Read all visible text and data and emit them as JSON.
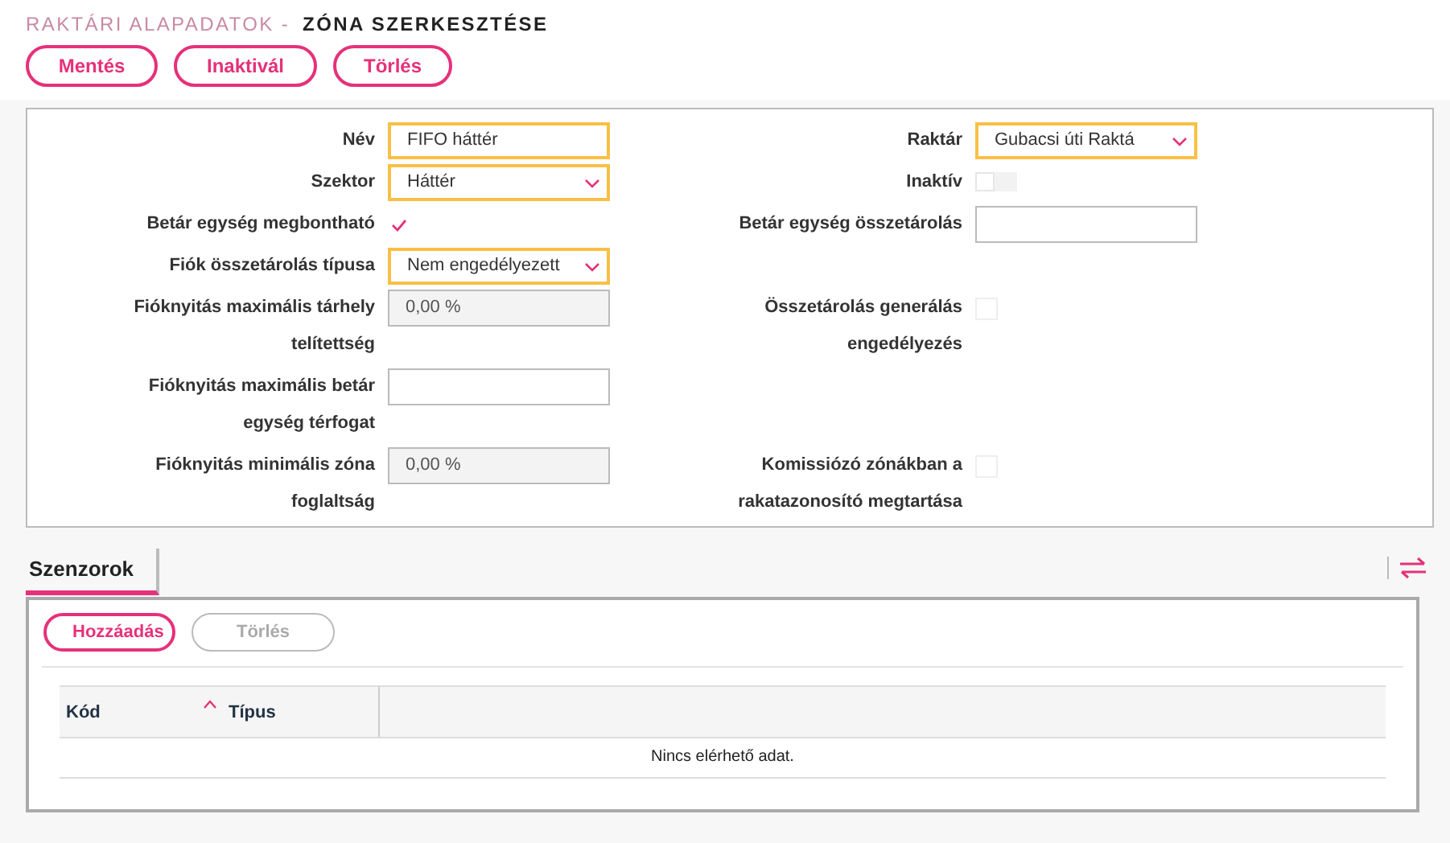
{
  "header": {
    "breadcrumb": "RAKTÁRI ALAPADATOK -",
    "title": "ZÓNA SZERKESZTÉSE"
  },
  "actions": [
    {
      "label": "Mentés",
      "disabled": false
    },
    {
      "label": "Inaktivál",
      "disabled": false
    },
    {
      "label": "Törlés",
      "disabled": false
    }
  ],
  "form": {
    "rows": [
      {
        "left": {
          "label": "Név",
          "kind": "text",
          "value": "FIFO háttér",
          "required": true,
          "disabled": false
        },
        "right": {
          "label": "Raktár",
          "kind": "select",
          "value": "Gubacsi úti Raktá",
          "required": true,
          "disabled": false
        }
      },
      {
        "left": {
          "label": "Szektor",
          "kind": "select",
          "value": "Háttér",
          "required": true,
          "disabled": false
        },
        "right": {
          "label": "Inaktív",
          "kind": "toggle",
          "on": false
        }
      },
      {
        "left": {
          "label": "Betár egység megbontható",
          "kind": "checkbox",
          "checked": true
        },
        "right": {
          "label": "Betár egység összetárolás",
          "kind": "text",
          "required": false,
          "disabled": false
        }
      },
      {
        "left": {
          "label": "Fiók összetárolás típusa",
          "kind": "select",
          "value": "Nem engedélyezett",
          "required": true,
          "disabled": false
        }
      },
      {
        "left": {
          "label": "Fióknyitás maximális tárhely telítettség",
          "kind": "text",
          "value": "0,00 %",
          "required": false,
          "disabled": true
        },
        "right": {
          "label": "Összetárolás generálás engedélyezés",
          "kind": "checkbox",
          "checked": false
        }
      },
      {
        "left": {
          "label": "Fióknyitás maximális betár egység térfogat",
          "kind": "text",
          "required": false,
          "disabled": false
        }
      },
      {
        "left": {
          "label": "Fióknyitás minimális zóna foglaltság",
          "kind": "text",
          "value": "0,00 %",
          "required": false,
          "disabled": true
        },
        "right": {
          "label": "Komissiózó zónákban a rakatazonosító megtartása",
          "kind": "checkbox",
          "checked": false
        }
      }
    ]
  },
  "tabs": [
    {
      "label": "Szenzorok",
      "selected": true
    }
  ],
  "sensors": {
    "buttons": [
      {
        "label": "Hozzáadás",
        "disabled": false
      },
      {
        "label": "Törlés",
        "disabled": true
      }
    ],
    "table": {
      "columns": [
        {
          "label": "Kód",
          "sorted": true
        },
        {
          "label": "Típus",
          "sorted": false
        }
      ],
      "empty_message": "Nincs elérhető adat."
    }
  }
}
